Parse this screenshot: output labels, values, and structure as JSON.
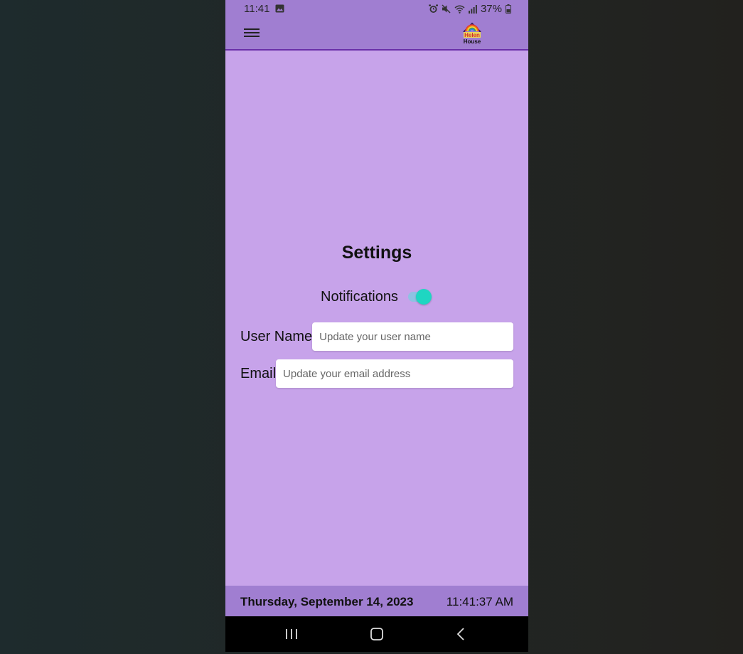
{
  "status_bar": {
    "time": "11:41",
    "battery": "37%"
  },
  "app_bar": {
    "menu_icon": "hamburger-menu-icon",
    "logo_text_line1": "Helen",
    "logo_text_line2": "House"
  },
  "settings": {
    "title": "Settings",
    "notifications_label": "Notifications",
    "notifications_enabled": true,
    "username_label": "User Name",
    "username_placeholder": "Update your user name",
    "username_value": "",
    "email_label": "Email",
    "email_placeholder": "Update your email address",
    "email_value": ""
  },
  "footer": {
    "date": "Thursday, September 14, 2023",
    "time": "11:41:37 AM"
  },
  "nav_bar": {
    "recents_icon": "recents-icon",
    "home_icon": "home-icon",
    "back_icon": "back-icon"
  },
  "colors": {
    "background": "#c7a3ea",
    "app_bar": "#a07ed1",
    "accent": "#1ed6c2",
    "divider": "#6a2fa8"
  }
}
